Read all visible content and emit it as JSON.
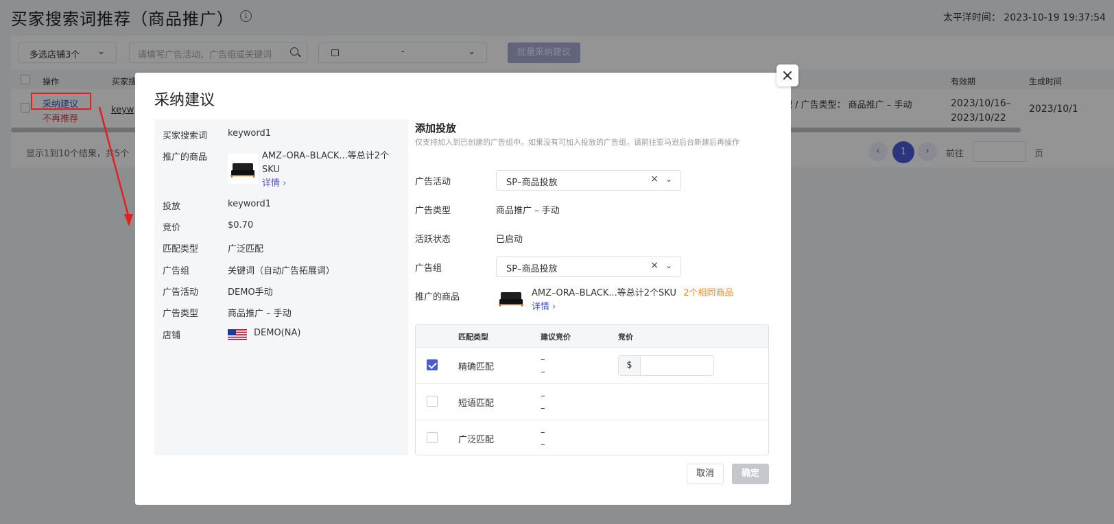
{
  "page": {
    "title": "买家搜索词推荐（商品推广）",
    "time_label": "太平洋时间： 2023-10-19 19:37:54"
  },
  "filters": {
    "shop_select": "多选店铺3个",
    "search_placeholder": "请填写广告活动、广告组或关键词",
    "date_separator": "-",
    "batch_button": "批量采纳建议"
  },
  "table": {
    "headers": {
      "op": "操作",
      "keyword": "买家搜",
      "validity": "有效期",
      "generated": "生成时间"
    },
    "row": {
      "accept": "采纳建议",
      "reject": "不再推荐",
      "keyword": "keyw",
      "info": "泛匹配   /   广告类型：  商品推广 – 手动",
      "validity_start": "2023/10/16–",
      "validity_end": "2023/10/22",
      "generated": "2023/10/1"
    }
  },
  "pager": {
    "summary": "显示1到10个结果，共5个",
    "prev": "‹",
    "current": "1",
    "next": "›",
    "goto": "前往",
    "page": "页"
  },
  "modal": {
    "title": "采纳建议",
    "left": {
      "rows": [
        {
          "label": "买家搜索词",
          "value": "keyword1"
        },
        {
          "label": "推广的商品",
          "value": ""
        },
        {
          "label": "投放",
          "value": "keyword1"
        },
        {
          "label": "竞价",
          "value": "$0.70"
        },
        {
          "label": "匹配类型",
          "value": "广泛匹配"
        },
        {
          "label": "广告组",
          "value": "关键词（自动广告拓展词）"
        },
        {
          "label": "广告活动",
          "value": "DEMO手动"
        },
        {
          "label": "广告类型",
          "value": "商品推广 – 手动"
        },
        {
          "label": "店铺",
          "value": "DEMO(NA)"
        }
      ],
      "product_name": "AMZ–ORA–BLACK...等总计2个SKU",
      "detail_link": "详情 ›"
    },
    "right": {
      "title": "添加投放",
      "desc": "仅支持加入到已创建的广告组中。如果没有可加入投放的广告组，请前往亚马逊后台新建后再操作",
      "campaign_label": "广告活动",
      "campaign_value": "SP–商品投放",
      "ad_type_label": "广告类型",
      "ad_type_value": "商品推广 – 手动",
      "status_label": "活跃状态",
      "status_value": "已启动",
      "group_label": "广告组",
      "group_value": "SP–商品投放",
      "product_label": "推广的商品",
      "product_name": "AMZ–ORA–BLACK...等总计2个SKU",
      "same_goods": "2个相同商品",
      "detail_link": "详情 ›"
    },
    "match_table": {
      "headers": {
        "type": "匹配类型",
        "suggested": "建议竞价",
        "bid": "竞价"
      },
      "rows": [
        {
          "type": "精确匹配",
          "sug1": "–",
          "sug2": "–",
          "checked": true
        },
        {
          "type": "短语匹配",
          "sug1": "–",
          "sug2": "–",
          "checked": false
        },
        {
          "type": "广泛匹配",
          "sug1": "–",
          "sug2": "–",
          "checked": false
        }
      ],
      "currency": "$"
    },
    "cancel": "取消",
    "ok": "确定"
  },
  "colors": {
    "accent": "#4b5bd8",
    "warning": "#f08a24",
    "danger": "#e02020"
  }
}
